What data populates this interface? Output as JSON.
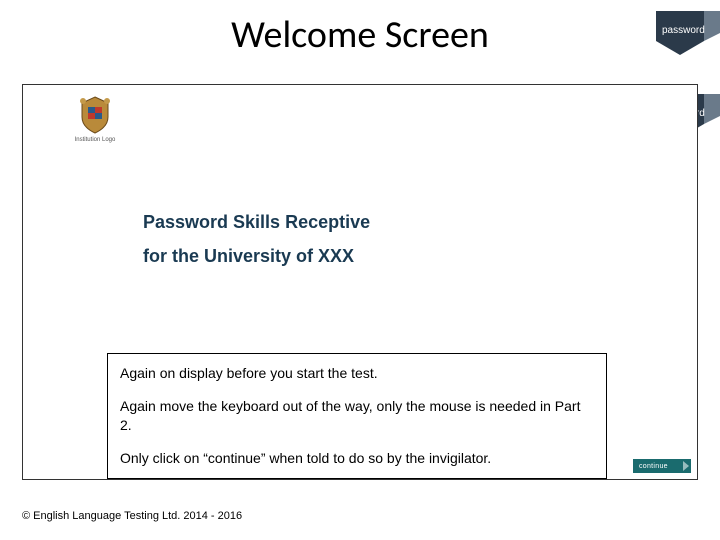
{
  "slide": {
    "title": "Welcome Screen"
  },
  "brand": {
    "label": "password"
  },
  "institution": {
    "caption": "Institution Logo"
  },
  "headline": {
    "line1": "Password Skills Receptive",
    "line2": "for the University of XXX"
  },
  "notes": {
    "p1": "Again on display before you start the test.",
    "p2": "Again move the keyboard out of the way, only the mouse is needed in Part 2.",
    "p3": "Only click on “continue” when told to do so by the invigilator."
  },
  "continue": {
    "label": "continue"
  },
  "footer": {
    "copyright": "© English Language Testing Ltd. 2014 - 2016"
  }
}
